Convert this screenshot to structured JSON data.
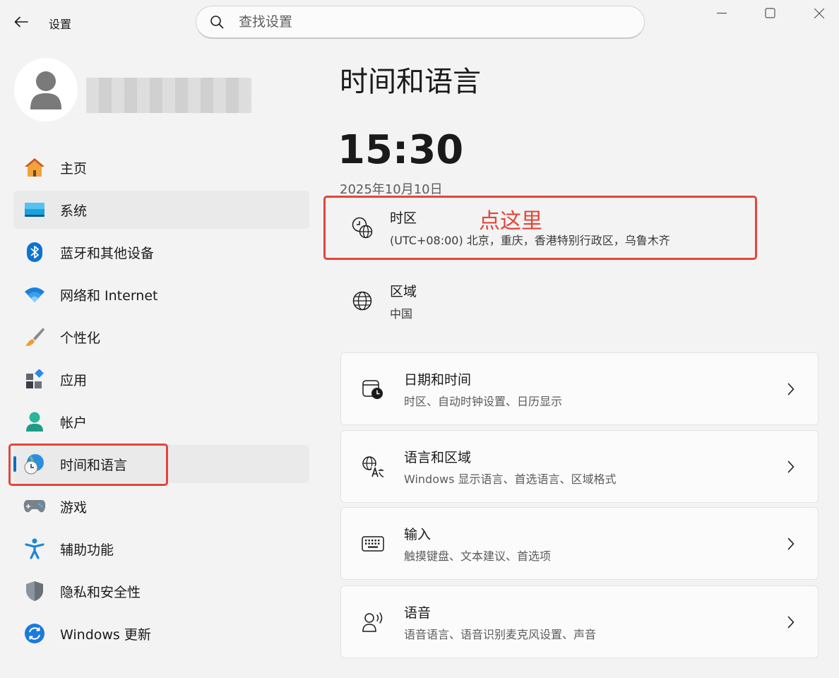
{
  "titlebar": {
    "app_title": "设置",
    "search_placeholder": "查找设置"
  },
  "sidebar": {
    "items": [
      {
        "label": "主页",
        "icon": "home-icon"
      },
      {
        "label": "系统",
        "icon": "system-icon"
      },
      {
        "label": "蓝牙和其他设备",
        "icon": "bluetooth-icon"
      },
      {
        "label": "网络和 Internet",
        "icon": "wifi-icon"
      },
      {
        "label": "个性化",
        "icon": "brush-icon"
      },
      {
        "label": "应用",
        "icon": "apps-icon"
      },
      {
        "label": "帐户",
        "icon": "account-icon"
      },
      {
        "label": "时间和语言",
        "icon": "time-language-icon",
        "selected": true
      },
      {
        "label": "游戏",
        "icon": "gamepad-icon"
      },
      {
        "label": "辅助功能",
        "icon": "accessibility-icon"
      },
      {
        "label": "隐私和安全性",
        "icon": "shield-icon"
      },
      {
        "label": "Windows 更新",
        "icon": "update-icon"
      }
    ]
  },
  "main": {
    "title": "时间和语言",
    "clock": "15:30",
    "date": "2025年10月10日",
    "timezone": {
      "title": "时区",
      "value": "(UTC+08:00) 北京，重庆，香港特别行政区，乌鲁木齐",
      "annotation": "点这里"
    },
    "region": {
      "title": "区域",
      "value": "中国"
    },
    "cards": [
      {
        "title": "日期和时间",
        "sub": "时区、自动时钟设置、日历显示",
        "icon": "calendar-clock-icon"
      },
      {
        "title": "语言和区域",
        "sub": "Windows 显示语言、首选语言、区域格式",
        "icon": "language-icon"
      },
      {
        "title": "输入",
        "sub": "触摸键盘、文本建议、首选项",
        "icon": "keyboard-icon"
      },
      {
        "title": "语音",
        "sub": "语音语言、语音识别麦克风设置、声音",
        "icon": "speech-icon"
      }
    ]
  },
  "colors": {
    "accent": "#0f6cbd",
    "annotation": "#e5443a",
    "background": "#f3f3f3"
  }
}
